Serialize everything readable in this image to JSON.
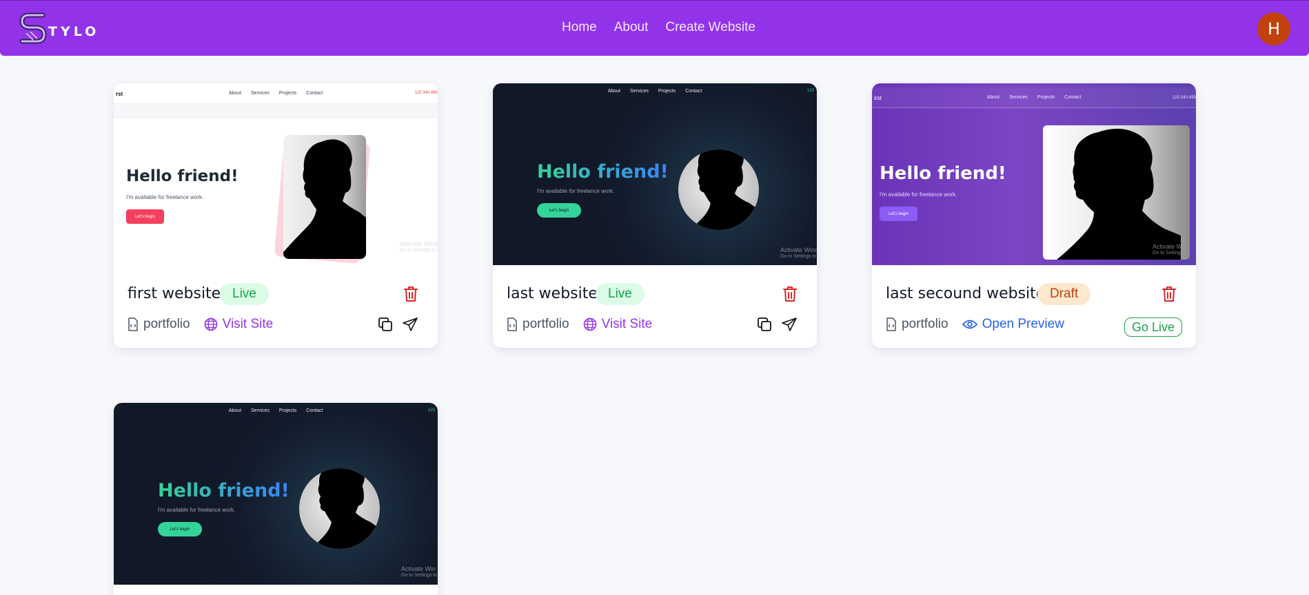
{
  "brand": {
    "name": "TYLO",
    "logo_icon": "stylo-s-logo"
  },
  "nav": {
    "links": [
      "Home",
      "About",
      "Create Website"
    ]
  },
  "user": {
    "initial": "H",
    "avatar_color": "#c2410c"
  },
  "colors": {
    "navbar": "#9233ea",
    "live": "#16a34a",
    "draft": "#c2410c",
    "delete": "#dc2626",
    "visit": "#9333ea",
    "preview": "#2563eb"
  },
  "cards": [
    {
      "title": "first website",
      "status": "Live",
      "type": "portfolio",
      "link_label": "Visit Site",
      "preview": {
        "logo": "rst",
        "menu": [
          "About",
          "Services",
          "Projects",
          "Contact"
        ],
        "phone": "120 340 890",
        "headline": "Hello friend!",
        "subtitle": "I'm available for freelance work.",
        "button": "Let's begin",
        "watermark1": "Activate Windo",
        "watermark2": "Go to Settings to ac"
      }
    },
    {
      "title": "last website",
      "status": "Live",
      "type": "portfolio",
      "link_label": "Visit Site",
      "preview": {
        "menu": [
          "About",
          "Services",
          "Projects",
          "Contact"
        ],
        "phone": "120",
        "headline": "Hello friend!",
        "subtitle": "I'm available for freelance work.",
        "button": "Let's begin",
        "watermark1": "Activate Wind",
        "watermark2": "Go to Settings to"
      }
    },
    {
      "title": "last secound website",
      "status": "Draft",
      "type": "portfolio",
      "link_label": "Open Preview",
      "action_label": "Go Live",
      "preview": {
        "logo": "irst",
        "menu": [
          "About",
          "Services",
          "Projects",
          "Contact"
        ],
        "phone": "120-340-890",
        "headline": "Hello friend!",
        "subtitle": "I'm available for freelance work.",
        "button": "Let's begin",
        "watermark1": "Activate W",
        "watermark2": "Go to Setting"
      }
    },
    {
      "preview": {
        "menu": [
          "About",
          "Services",
          "Projects",
          "Contact"
        ],
        "phone": "120",
        "headline": "Hello friend!",
        "subtitle": "I'm available for freelance work.",
        "button": "Let's begin",
        "watermark1": "Activate Win",
        "watermark2": "Go to Settings to"
      }
    }
  ]
}
